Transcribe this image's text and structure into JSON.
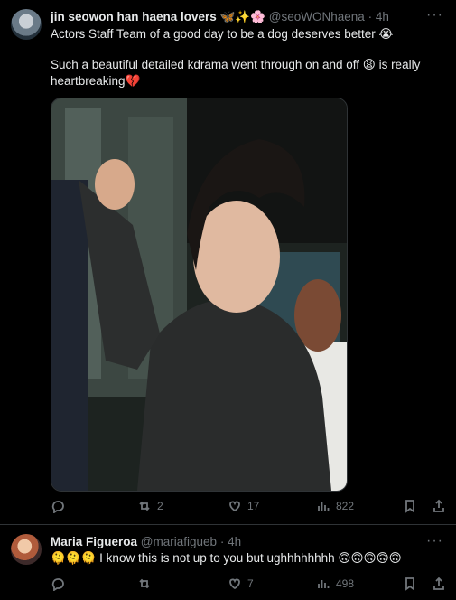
{
  "tweet1": {
    "author_name": "jin seowon han haena lovers",
    "name_emojis": "🦋✨🌸",
    "handle": "@seoWONhaena",
    "separator": "·",
    "time": "4h",
    "more": "···",
    "line1": "Actors Staff  Team of a good day to be a dog  deserves better 😭",
    "line2": "Such a beautiful detailed kdrama went through on and off 😩 is really heartbreaking💔",
    "stats": {
      "retweets": "2",
      "likes": "17",
      "views": "822"
    }
  },
  "tweet2": {
    "author_name": "Maria Figueroa",
    "handle": "@mariafigueb",
    "separator": "·",
    "time": "4h",
    "more": "···",
    "text": "🫠🫠🫠 I know this is not up to you but ughhhhhhhh 🙃🙃🙃🙃🙃",
    "stats": {
      "likes": "7",
      "views": "498"
    }
  },
  "colors": {
    "background": "#000000",
    "text": "#e7e9ea",
    "muted": "#71767b",
    "divider": "#2f3336"
  }
}
